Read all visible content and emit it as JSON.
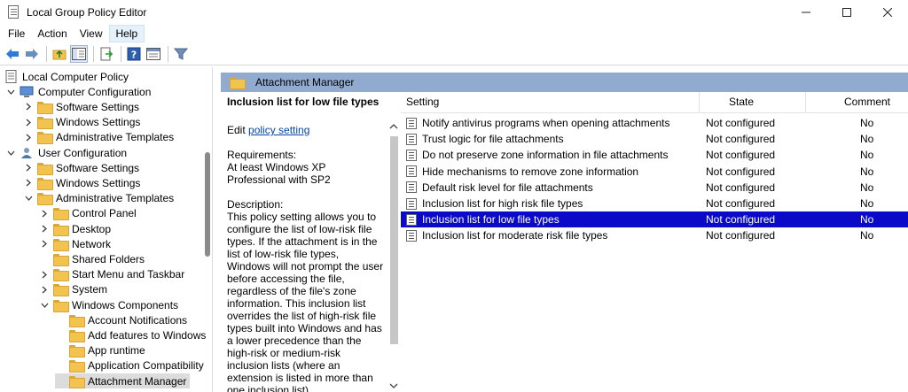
{
  "window": {
    "title": "Local Group Policy Editor"
  },
  "menu": [
    "File",
    "Action",
    "View",
    "Help"
  ],
  "tree": [
    {
      "label": "Local Computer Policy",
      "level": 0,
      "twisty": "",
      "icon": "policy"
    },
    {
      "label": "Computer Configuration",
      "level": 0,
      "twisty": "down",
      "icon": "computer"
    },
    {
      "label": "Software Settings",
      "level": 1,
      "twisty": "right",
      "icon": "folder"
    },
    {
      "label": "Windows Settings",
      "level": 1,
      "twisty": "right",
      "icon": "folder"
    },
    {
      "label": "Administrative Templates",
      "level": 1,
      "twisty": "right",
      "icon": "folder"
    },
    {
      "label": "User Configuration",
      "level": 0,
      "twisty": "down",
      "icon": "user"
    },
    {
      "label": "Software Settings",
      "level": 1,
      "twisty": "right",
      "icon": "folder"
    },
    {
      "label": "Windows Settings",
      "level": 1,
      "twisty": "right",
      "icon": "folder"
    },
    {
      "label": "Administrative Templates",
      "level": 1,
      "twisty": "down",
      "icon": "folder"
    },
    {
      "label": "Control Panel",
      "level": 2,
      "twisty": "right",
      "icon": "folder"
    },
    {
      "label": "Desktop",
      "level": 2,
      "twisty": "right",
      "icon": "folder"
    },
    {
      "label": "Network",
      "level": 2,
      "twisty": "right",
      "icon": "folder"
    },
    {
      "label": "Shared Folders",
      "level": 2,
      "twisty": "",
      "icon": "folder"
    },
    {
      "label": "Start Menu and Taskbar",
      "level": 2,
      "twisty": "right",
      "icon": "folder"
    },
    {
      "label": "System",
      "level": 2,
      "twisty": "right",
      "icon": "folder"
    },
    {
      "label": "Windows Components",
      "level": 2,
      "twisty": "down",
      "icon": "folder"
    },
    {
      "label": "Account Notifications",
      "level": 3,
      "twisty": "",
      "icon": "folder"
    },
    {
      "label": "Add features to Windows",
      "level": 3,
      "twisty": "",
      "icon": "folder"
    },
    {
      "label": "App runtime",
      "level": 3,
      "twisty": "",
      "icon": "folder"
    },
    {
      "label": "Application Compatibility",
      "level": 3,
      "twisty": "",
      "icon": "folder"
    },
    {
      "label": "Attachment Manager",
      "level": 3,
      "twisty": "",
      "icon": "folder",
      "selected": true
    }
  ],
  "extension": {
    "header": "Attachment Manager",
    "desc_title": "Inclusion list for low file types",
    "edit_prefix": "Edit ",
    "edit_link": "policy setting ",
    "requirements_label": "Requirements:",
    "requirements": "At least Windows XP Professional with SP2",
    "description_label": "Description:",
    "description": "This policy setting allows you to configure the list of low-risk file types. If the attachment is in the list of low-risk file types, Windows will not prompt the user before accessing the file, regardless of the file's zone information. This inclusion list overrides the list of high-risk file types built into Windows and has a lower precedence than the high-risk or medium-risk inclusion lists (where an extension is listed in more than one inclusion list)."
  },
  "list": {
    "columns": {
      "setting": "Setting",
      "state": "State",
      "comment": "Comment"
    },
    "rows": [
      {
        "setting": "Notify antivirus programs when opening attachments",
        "state": "Not configured",
        "comment": "No"
      },
      {
        "setting": "Trust logic for file attachments",
        "state": "Not configured",
        "comment": "No"
      },
      {
        "setting": "Do not preserve zone information in file attachments",
        "state": "Not configured",
        "comment": "No"
      },
      {
        "setting": "Hide mechanisms to remove zone information",
        "state": "Not configured",
        "comment": "No"
      },
      {
        "setting": "Default risk level for file attachments",
        "state": "Not configured",
        "comment": "No"
      },
      {
        "setting": "Inclusion list for high risk file types",
        "state": "Not configured",
        "comment": "No"
      },
      {
        "setting": "Inclusion list for low file types",
        "state": "Not configured",
        "comment": "No",
        "selected": true
      },
      {
        "setting": "Inclusion list for moderate risk file types",
        "state": "Not configured",
        "comment": "No"
      }
    ]
  },
  "colors": {
    "header_band": "#91abd0",
    "selection": "#0a0ac8",
    "tree_selection": "#dcdcdc",
    "link": "#0645ad"
  }
}
